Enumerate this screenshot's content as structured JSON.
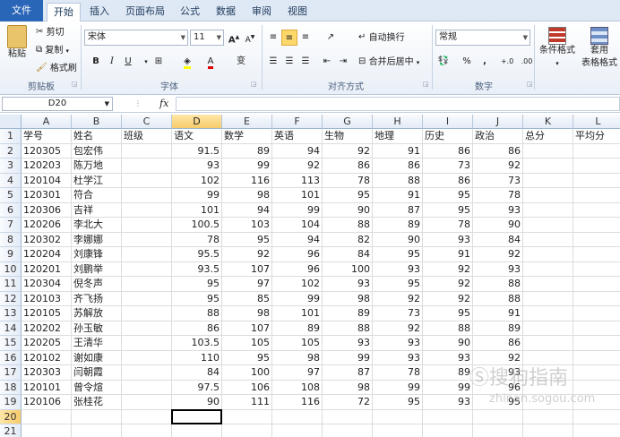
{
  "tabs": [
    "文件",
    "开始",
    "插入",
    "页面布局",
    "公式",
    "数据",
    "审阅",
    "视图"
  ],
  "clipboard": {
    "paste": "粘贴",
    "cut": "剪切",
    "copy": "复制",
    "format_painter": "格式刷",
    "group": "剪贴板"
  },
  "font": {
    "name": "宋体",
    "size": "11",
    "grow": "A",
    "shrink": "A",
    "bold": "B",
    "italic": "I",
    "underline": "U",
    "font_color": "A",
    "wen": "变",
    "group": "字体"
  },
  "alignment": {
    "wrap": "自动换行",
    "merge": "合并后居中",
    "group": "对齐方式"
  },
  "number": {
    "format": "常规",
    "percent": "%",
    "comma": ",",
    "inc": "+.0",
    "dec": ".00",
    "group": "数字"
  },
  "styles": {
    "conditional": "条件格式",
    "table": "套用",
    "table2": "表格格式"
  },
  "formula_bar": {
    "name_box": "D20",
    "fx": "fx",
    "value": ""
  },
  "columns": [
    "A",
    "B",
    "C",
    "D",
    "E",
    "F",
    "G",
    "H",
    "I",
    "J",
    "K",
    "L"
  ],
  "selected_column": "D",
  "selected_row": 20,
  "row_numbers": [
    "1",
    "2",
    "3",
    "4",
    "5",
    "6",
    "7",
    "8",
    "9",
    "10",
    "11",
    "12",
    "13",
    "14",
    "15",
    "16",
    "17",
    "18",
    "19",
    "20",
    "21"
  ],
  "headers": [
    "学号",
    "姓名",
    "班级",
    "语文",
    "数学",
    "英语",
    "生物",
    "地理",
    "历史",
    "政治",
    "总分",
    "平均分"
  ],
  "rows": [
    [
      "120305",
      "包宏伟",
      "",
      "91.5",
      "89",
      "94",
      "92",
      "91",
      "86",
      "86",
      "",
      ""
    ],
    [
      "120203",
      "陈万地",
      "",
      "93",
      "99",
      "92",
      "86",
      "86",
      "73",
      "92",
      "",
      ""
    ],
    [
      "120104",
      "杜学江",
      "",
      "102",
      "116",
      "113",
      "78",
      "88",
      "86",
      "73",
      "",
      ""
    ],
    [
      "120301",
      "符合",
      "",
      "99",
      "98",
      "101",
      "95",
      "91",
      "95",
      "78",
      "",
      ""
    ],
    [
      "120306",
      "吉祥",
      "",
      "101",
      "94",
      "99",
      "90",
      "87",
      "95",
      "93",
      "",
      ""
    ],
    [
      "120206",
      "李北大",
      "",
      "100.5",
      "103",
      "104",
      "88",
      "89",
      "78",
      "90",
      "",
      ""
    ],
    [
      "120302",
      "李娜娜",
      "",
      "78",
      "95",
      "94",
      "82",
      "90",
      "93",
      "84",
      "",
      ""
    ],
    [
      "120204",
      "刘康锋",
      "",
      "95.5",
      "92",
      "96",
      "84",
      "95",
      "91",
      "92",
      "",
      ""
    ],
    [
      "120201",
      "刘鹏举",
      "",
      "93.5",
      "107",
      "96",
      "100",
      "93",
      "92",
      "93",
      "",
      ""
    ],
    [
      "120304",
      "倪冬声",
      "",
      "95",
      "97",
      "102",
      "93",
      "95",
      "92",
      "88",
      "",
      ""
    ],
    [
      "120103",
      "齐飞扬",
      "",
      "95",
      "85",
      "99",
      "98",
      "92",
      "92",
      "88",
      "",
      ""
    ],
    [
      "120105",
      "苏解放",
      "",
      "88",
      "98",
      "101",
      "89",
      "73",
      "95",
      "91",
      "",
      ""
    ],
    [
      "120202",
      "孙玉敏",
      "",
      "86",
      "107",
      "89",
      "88",
      "92",
      "88",
      "89",
      "",
      ""
    ],
    [
      "120205",
      "王清华",
      "",
      "103.5",
      "105",
      "105",
      "93",
      "93",
      "90",
      "86",
      "",
      ""
    ],
    [
      "120102",
      "谢如康",
      "",
      "110",
      "95",
      "98",
      "99",
      "93",
      "93",
      "92",
      "",
      ""
    ],
    [
      "120303",
      "闫朝霞",
      "",
      "84",
      "100",
      "97",
      "87",
      "78",
      "89",
      "93",
      "",
      ""
    ],
    [
      "120101",
      "曾令煊",
      "",
      "97.5",
      "106",
      "108",
      "98",
      "99",
      "99",
      "96",
      "",
      ""
    ],
    [
      "120106",
      "张桂花",
      "",
      "90",
      "111",
      "116",
      "72",
      "95",
      "93",
      "95",
      "",
      ""
    ]
  ],
  "watermark": {
    "line1": "Ⓢ搜狗指南",
    "line2": "zhinan.sogou.com"
  }
}
